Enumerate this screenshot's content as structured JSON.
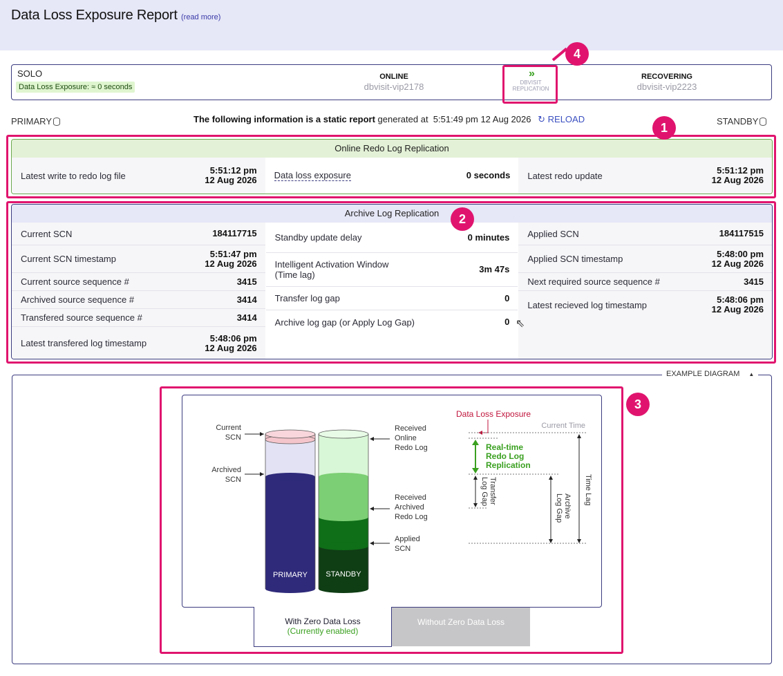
{
  "header": {
    "title": "Data Loss Exposure Report",
    "read_more": "(read more)"
  },
  "status": {
    "mode": "SOLO",
    "exposure_badge": "Data Loss Exposure: ≈ 0 seconds",
    "primary": {
      "state": "ONLINE",
      "host": "dbvisit-vip2178"
    },
    "replication": {
      "line1": "DBVISIT",
      "line2": "REPLICATION"
    },
    "standby": {
      "state": "RECOVERING",
      "host": "dbvisit-vip2223"
    }
  },
  "info": {
    "primary_label": "PRIMARY",
    "standby_label": "STANDBY",
    "static_text": "The following information is a static report",
    "generated_text": "generated at",
    "generated_time": "5:51:49 pm 12 Aug 2026",
    "reload": "RELOAD"
  },
  "online_panel": {
    "title": "Online Redo Log Replication",
    "left": {
      "label": "Latest write to redo log file",
      "time": "5:51:12 pm",
      "date": "12 Aug 2026"
    },
    "mid": {
      "label": "Data loss exposure",
      "value": "0 seconds"
    },
    "right": {
      "label": "Latest redo update",
      "time": "5:51:12 pm",
      "date": "12 Aug 2026"
    }
  },
  "archive_panel": {
    "title": "Archive Log Replication",
    "left": [
      {
        "label": "Current SCN",
        "v1": "184117715",
        "v2": ""
      },
      {
        "label": "Current SCN timestamp",
        "v1": "5:51:47 pm",
        "v2": "12 Aug 2026"
      },
      {
        "label": "Current source sequence #",
        "v1": "3415",
        "v2": ""
      },
      {
        "label": "Archived source sequence #",
        "v1": "3414",
        "v2": ""
      },
      {
        "label": "Transfered source sequence #",
        "v1": "3414",
        "v2": ""
      },
      {
        "label": "Latest transfered log timestamp",
        "v1": "5:48:06 pm",
        "v2": "12 Aug 2026"
      }
    ],
    "mid": [
      {
        "label": "Standby update delay",
        "label2": "",
        "value": "0 minutes"
      },
      {
        "label": "Intelligent Activation Window",
        "label2": "(Time lag)",
        "value": "3m 47s"
      },
      {
        "label": "Transfer log gap",
        "label2": "",
        "value": "0"
      },
      {
        "label": "Archive log gap (or Apply Log Gap)",
        "label2": "",
        "value": "0"
      }
    ],
    "right": [
      {
        "label": "Applied SCN",
        "v1": "184117515",
        "v2": ""
      },
      {
        "label": "Applied SCN timestamp",
        "v1": "5:48:00 pm",
        "v2": "12 Aug 2026"
      },
      {
        "label": "Next required source sequence #",
        "v1": "3415",
        "v2": ""
      },
      {
        "label": "Latest recieved log timestamp",
        "v1": "5:48:06 pm",
        "v2": "12 Aug 2026"
      }
    ]
  },
  "example": {
    "toggle_label": "EXAMPLE DIAGRAM",
    "toggle_icon": "▲",
    "diagram": {
      "primary_label": "PRIMARY",
      "standby_label": "STANDBY",
      "current_scn": [
        "Current",
        "SCN"
      ],
      "archived_scn": [
        "Archived",
        "SCN"
      ],
      "received_online": [
        "Received",
        "Online",
        "Redo Log"
      ],
      "received_archived": [
        "Received",
        "Archived",
        "Redo Log"
      ],
      "applied_scn": [
        "Applied",
        "SCN"
      ],
      "data_loss_exposure": "Data Loss Exposure",
      "current_time": "Current Time",
      "realtime": [
        "Real-time",
        "Redo Log",
        "Replication"
      ],
      "transfer_gap": [
        "Transfer",
        "Log Gap"
      ],
      "archive_gap": [
        "Archive",
        "Log Gap"
      ],
      "time_lag": "Time Lag"
    },
    "tab_on": {
      "label": "With Zero Data Loss",
      "sub": "(Currently enabled)"
    },
    "tab_off": {
      "label": "Without Zero Data Loss"
    }
  },
  "callouts": [
    "1",
    "2",
    "3",
    "4"
  ],
  "colors": {
    "highlight": "#e0146e",
    "header_bg": "#e6e7f7",
    "border": "#3b3b80",
    "primary_db": "#2f2a7a",
    "standby_db": "#0f6e18",
    "green_accent": "#3aa020"
  }
}
